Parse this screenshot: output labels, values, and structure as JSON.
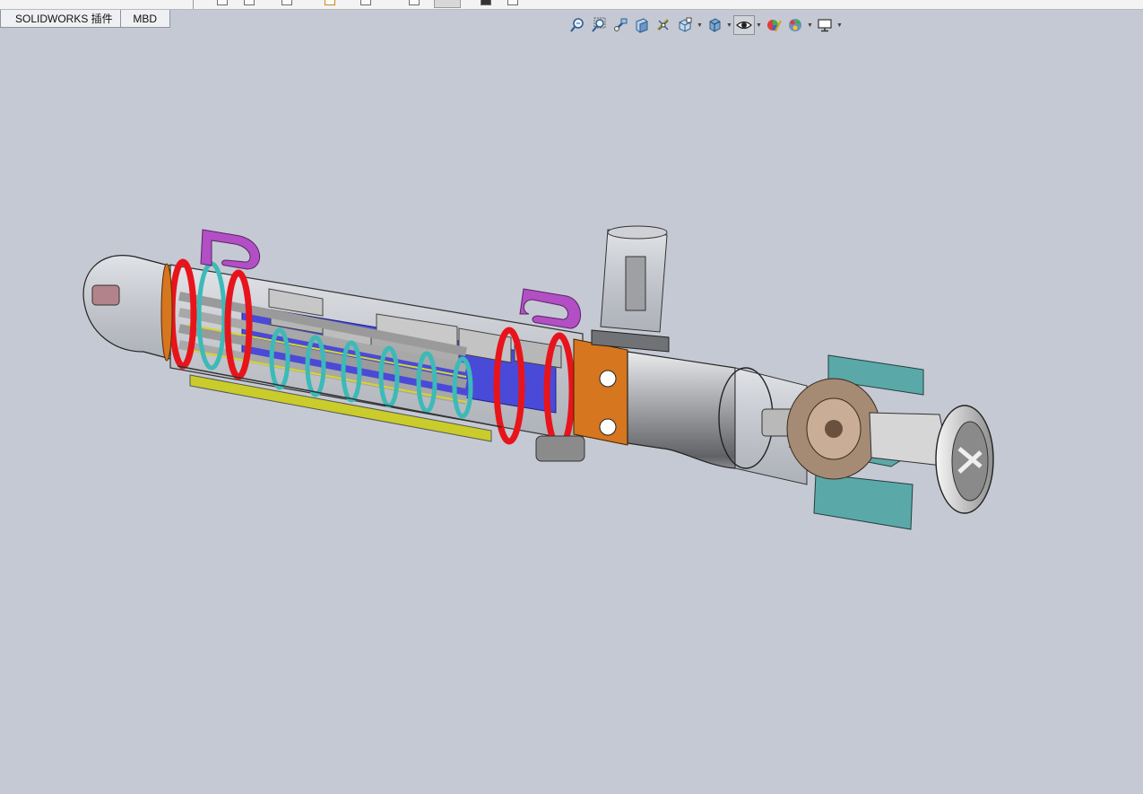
{
  "command_manager": {
    "tabs": [
      {
        "label": "SOLIDWORKS 插件"
      },
      {
        "label": "MBD"
      }
    ]
  },
  "view_toolbar": {
    "tools": [
      {
        "icon": "zoom-to-fit-icon"
      },
      {
        "icon": "zoom-to-area-icon"
      },
      {
        "icon": "previous-view-icon"
      },
      {
        "icon": "section-view-icon"
      },
      {
        "icon": "dynamic-annotation-views-icon"
      },
      {
        "icon": "view-orientation-icon"
      },
      {
        "icon": "display-style-icon"
      },
      {
        "icon": "hide-show-items-icon"
      },
      {
        "icon": "edit-appearance-icon"
      },
      {
        "icon": "apply-scene-icon"
      },
      {
        "icon": "view-settings-icon"
      }
    ]
  },
  "graphics_area": {
    "background": "#c5c9d3",
    "model_colors": {
      "hull": "#9c9ea3",
      "band_red": "#e8141b",
      "band_cyan": "#3cbab8",
      "handle_purple": "#b24fc4",
      "orange_ring": "#d6761f",
      "yellow_rail": "#c9cc2a",
      "fin_teal": "#5aa9a8",
      "tank_blue": "#4a4ad8"
    }
  }
}
